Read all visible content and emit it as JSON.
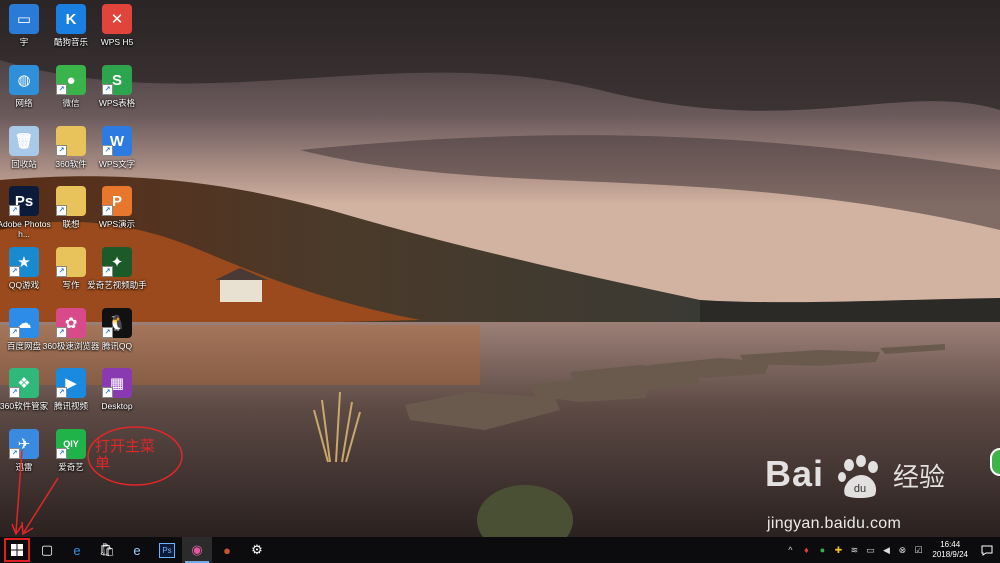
{
  "desktop": {
    "icons": [
      {
        "label": "宇",
        "icon": "computer-icon",
        "color": "#2a7ad8",
        "glyph": "▭"
      },
      {
        "label": "酷狗音乐",
        "icon": "kugou-icon",
        "color": "#1a7fe0",
        "glyph": "K"
      },
      {
        "label": "WPS H5",
        "icon": "wps-h5-icon",
        "color": "#e0443a",
        "glyph": "✕"
      },
      {
        "label": "网络",
        "icon": "network-icon",
        "color": "#2f8fd8",
        "glyph": "◍"
      },
      {
        "label": "微信",
        "icon": "wechat-icon",
        "color": "#3ab34a",
        "glyph": "●"
      },
      {
        "label": "WPS表格",
        "icon": "wps-sheet-icon",
        "color": "#2da44e",
        "glyph": "S"
      },
      {
        "label": "回收站",
        "icon": "recycle-bin-icon",
        "color": "#a9c9e8",
        "glyph": "🗑"
      },
      {
        "label": "360软件",
        "icon": "folder-icon",
        "color": "#e8c25a",
        "glyph": ""
      },
      {
        "label": "WPS文字",
        "icon": "wps-writer-icon",
        "color": "#2d7be0",
        "glyph": "W"
      },
      {
        "label": "Adobe Photosh...",
        "icon": "photoshop-icon",
        "color": "#0d1b3a",
        "glyph": "Ps"
      },
      {
        "label": "联想",
        "icon": "folder-icon",
        "color": "#e8c25a",
        "glyph": ""
      },
      {
        "label": "WPS演示",
        "icon": "wps-presentation-icon",
        "color": "#e8772e",
        "glyph": "P"
      },
      {
        "label": "QQ游戏",
        "icon": "qq-game-icon",
        "color": "#1a8ad0",
        "glyph": "★"
      },
      {
        "label": "写作",
        "icon": "folder-icon",
        "color": "#e8c25a",
        "glyph": ""
      },
      {
        "label": "爱奇艺视频助手",
        "icon": "iqiyi-helper-icon",
        "color": "#1c5a2a",
        "glyph": "✦"
      },
      {
        "label": "百度网盘",
        "icon": "baidu-netdisk-icon",
        "color": "#2d8ce8",
        "glyph": "☁"
      },
      {
        "label": "360极速浏览器",
        "icon": "360-browser-icon",
        "color": "#d84a8a",
        "glyph": "✿"
      },
      {
        "label": "腾讯QQ",
        "icon": "qq-icon",
        "color": "#111111",
        "glyph": "🐧"
      },
      {
        "label": "360软件管家",
        "icon": "360-manager-icon",
        "color": "#2fb87a",
        "glyph": "❖"
      },
      {
        "label": "腾讯视频",
        "icon": "tencent-video-icon",
        "color": "#1a8ae0",
        "glyph": "▶"
      },
      {
        "label": "Desktop",
        "icon": "winrar-icon",
        "color": "#8a3ab0",
        "glyph": "▦"
      },
      {
        "label": "迅雷",
        "icon": "xunlei-icon",
        "color": "#3a8ae0",
        "glyph": "✈"
      },
      {
        "label": "爱奇艺",
        "icon": "iqiyi-icon",
        "color": "#1fb34a",
        "glyph": "QIY"
      }
    ],
    "annotation": "打开主菜单"
  },
  "watermark": {
    "brand": "Bai",
    "brand_cn": "经验",
    "url": "jingyan.baidu.com"
  },
  "taskbar": {
    "start": {
      "icon": "windows-logo-icon"
    },
    "pinned": [
      {
        "name": "task-view-button",
        "icon": "task-view-icon",
        "glyph": "▢"
      },
      {
        "name": "edge-button",
        "icon": "edge-icon",
        "glyph": "e"
      },
      {
        "name": "store-button",
        "icon": "store-icon",
        "glyph": "🛍"
      },
      {
        "name": "ie-button",
        "icon": "ie-icon",
        "glyph": "e"
      },
      {
        "name": "photoshop-button",
        "icon": "photoshop-icon",
        "glyph": "Ps"
      },
      {
        "name": "chrome-button",
        "icon": "colorful-circle-icon",
        "glyph": "◉"
      },
      {
        "name": "basketball-app-button",
        "icon": "basketball-icon",
        "glyph": "●"
      },
      {
        "name": "settings-button",
        "icon": "gear-icon",
        "glyph": "⚙"
      }
    ],
    "tray": [
      {
        "name": "tray-overflow",
        "icon": "chevron-up-icon",
        "glyph": "^"
      },
      {
        "name": "tray-app-1",
        "icon": "app-icon",
        "glyph": "♦"
      },
      {
        "name": "tray-wechat",
        "icon": "wechat-icon",
        "glyph": "●"
      },
      {
        "name": "tray-360",
        "icon": "shield-icon",
        "glyph": "✚"
      },
      {
        "name": "tray-wifi",
        "icon": "wifi-icon",
        "glyph": "≋"
      },
      {
        "name": "tray-battery",
        "icon": "battery-icon",
        "glyph": "▭"
      },
      {
        "name": "tray-volume",
        "icon": "volume-icon",
        "glyph": "◀"
      },
      {
        "name": "tray-close",
        "icon": "close-circle-icon",
        "glyph": "⊗"
      },
      {
        "name": "tray-checkbox",
        "icon": "checkbox-icon",
        "glyph": "☑"
      }
    ],
    "clock": {
      "time": "16:44",
      "date": "2018/9/24"
    }
  }
}
